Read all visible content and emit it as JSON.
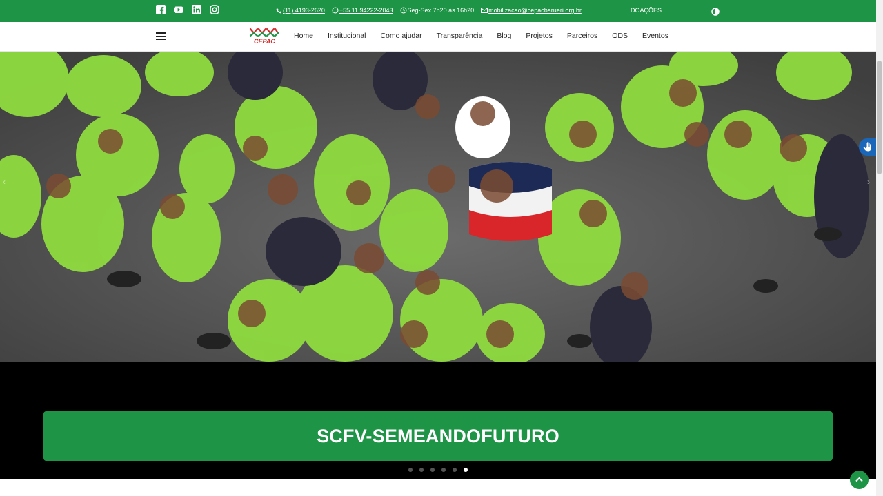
{
  "topbar": {
    "phone": "(11) 4193-2620",
    "whatsapp": "+55 11 94222-2043",
    "hours": "Seg-Sex 7h20 às 16h20",
    "email": "mobilizacao@cepacbarueri.org.br",
    "donate": "DOAÇÕES",
    "social_icons": [
      "facebook-icon",
      "youtube-icon",
      "linkedin-icon",
      "instagram-icon"
    ]
  },
  "navbar": {
    "logo_text": "CEPAC",
    "menu": [
      "Home",
      "Institucional",
      "Como ajudar",
      "Transparência",
      "Blog",
      "Projetos",
      "Parceiros",
      "ODS",
      "Eventos"
    ]
  },
  "slider": {
    "caption": "SCFV-SEMEANDOFUTURO",
    "slide_count": 6,
    "active_slide": 6
  },
  "colors": {
    "brand_green": "#1e9446",
    "shirt_green": "#8fdc3f",
    "accessibility_blue": "#1a66b8"
  }
}
